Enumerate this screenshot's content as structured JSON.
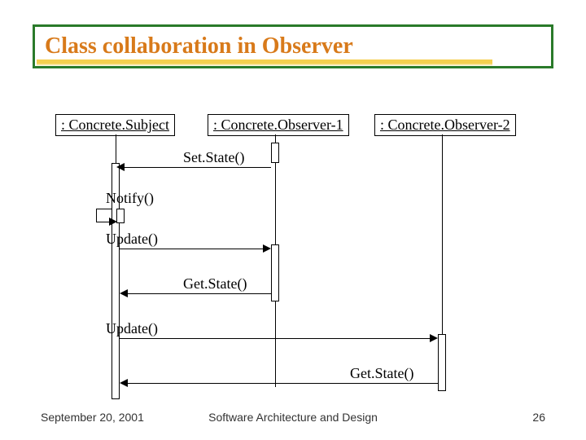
{
  "title": "Class collaboration in Observer",
  "actors": {
    "subject": ": Concrete.Subject",
    "observer1": ": Concrete.Observer-1",
    "observer2": ": Concrete.Observer-2"
  },
  "messages": {
    "setState": "Set.State()",
    "notify": "Notify()",
    "update1": "Update()",
    "getState1": "Get.State()",
    "update2": "Update()",
    "getState2": "Get.State()"
  },
  "footer": {
    "date": "September 20, 2001",
    "center": "Software Architecture and Design",
    "page": "26"
  },
  "chart_data": {
    "type": "table",
    "description": "UML sequence diagram for Observer pattern collaboration",
    "lifelines": [
      "Concrete.Subject",
      "Concrete.Observer-1",
      "Concrete.Observer-2"
    ],
    "messages": [
      {
        "from": "Concrete.Observer-1",
        "to": "Concrete.Subject",
        "label": "Set.State()"
      },
      {
        "from": "Concrete.Subject",
        "to": "Concrete.Subject",
        "label": "Notify()"
      },
      {
        "from": "Concrete.Subject",
        "to": "Concrete.Observer-1",
        "label": "Update()"
      },
      {
        "from": "Concrete.Observer-1",
        "to": "Concrete.Subject",
        "label": "Get.State()"
      },
      {
        "from": "Concrete.Subject",
        "to": "Concrete.Observer-2",
        "label": "Update()"
      },
      {
        "from": "Concrete.Observer-2",
        "to": "Concrete.Subject",
        "label": "Get.State()"
      }
    ]
  }
}
